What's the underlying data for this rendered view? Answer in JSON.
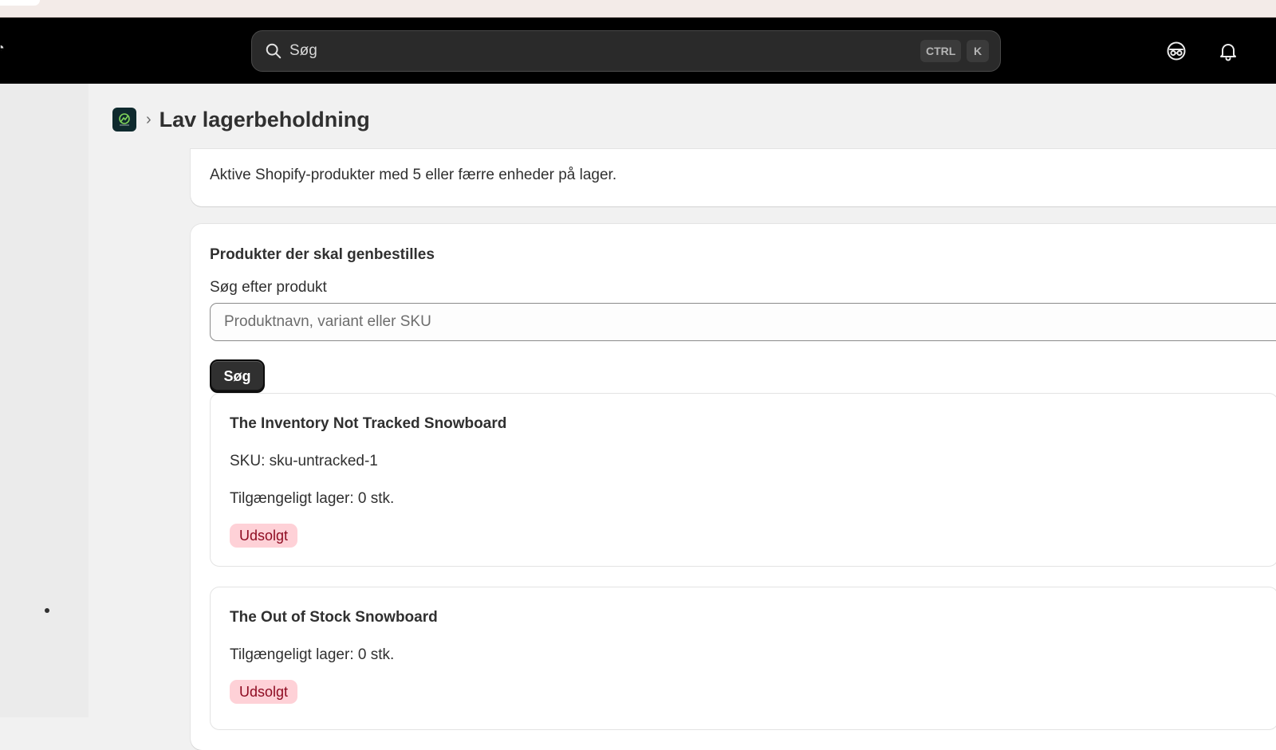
{
  "topbar": {
    "search_placeholder": "Søg",
    "shortcut_ctrl": "CTRL",
    "shortcut_k": "K"
  },
  "page": {
    "title": "Lav lagerbeholdning"
  },
  "info_card": {
    "description": "Aktive Shopify-produkter med 5 eller færre enheder på lager."
  },
  "products_card": {
    "title": "Produkter der skal genbestilles",
    "search_label": "Søg efter produkt",
    "search_placeholder": "Produktnavn, variant eller SKU",
    "search_button": "Søg",
    "items": [
      {
        "name": "The Inventory Not Tracked Snowboard",
        "sku": "SKU: sku-untracked-1",
        "stock": "Tilgængeligt lager: 0 stk.",
        "status": "Udsolgt"
      },
      {
        "name": "The Out of Stock Snowboard",
        "stock": "Tilgængeligt lager: 0 stk.",
        "status": "Udsolgt"
      }
    ]
  },
  "colors": {
    "topbar_bg": "#000000",
    "badge_bg": "#fed1d7",
    "badge_text": "#8e0b21",
    "primary_button": "#303030"
  },
  "icons": [
    "search-icon",
    "incognito-icon",
    "bell-icon",
    "app-logo-icon",
    "chevron-right-icon"
  ]
}
